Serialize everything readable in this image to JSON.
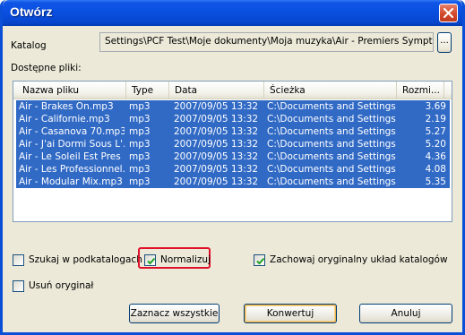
{
  "window": {
    "title": "Otwórz"
  },
  "catalog": {
    "label": "Katalog",
    "path": "Settings\\PCF Test\\Moje dokumenty\\Moja muzyka\\Air - Premiers Symptomes",
    "browse_label": "..."
  },
  "files": {
    "label": "Dostępne pliki:",
    "columns": [
      "Nazwa pliku",
      "Type",
      "Data",
      "Ścieżka",
      "Rozmi..."
    ],
    "rows": [
      [
        "Air - Brakes On.mp3",
        "mp3",
        "2007/09/05 13:32",
        "C:\\Documents and Settings...",
        "3.69"
      ],
      [
        "Air - Californie.mp3",
        "mp3",
        "2007/09/05 13:32",
        "C:\\Documents and Settings...",
        "2.19"
      ],
      [
        "Air - Casanova 70.mp3",
        "mp3",
        "2007/09/05 13:32",
        "C:\\Documents and Settings...",
        "5.27"
      ],
      [
        "Air - J'ai Dormi Sous L'...",
        "mp3",
        "2007/09/05 13:32",
        "C:\\Documents and Settings...",
        "5.20"
      ],
      [
        "Air - Le Soleil Est Pres ...",
        "mp3",
        "2007/09/05 13:32",
        "C:\\Documents and Settings...",
        "4.36"
      ],
      [
        "Air - Les Professionnel...",
        "mp3",
        "2007/09/05 13:32",
        "C:\\Documents and Settings...",
        "4.08"
      ],
      [
        "Air - Modular Mix.mp3",
        "mp3",
        "2007/09/05 13:32",
        "C:\\Documents and Settings...",
        "5.35"
      ]
    ],
    "selection_color": "#316ac5"
  },
  "options": {
    "subfolders": {
      "label": "Szukaj w podkatalogach",
      "checked": false
    },
    "normalize": {
      "label": "Normalizuj",
      "checked": true
    },
    "keep_structure": {
      "label": "Zachowaj oryginalny układ katalogów",
      "checked": true
    },
    "delete_original": {
      "label": "Usuń oryginał",
      "checked": false
    }
  },
  "buttons": {
    "select_all": "Zaznacz wszystkie",
    "convert": "Konwertuj",
    "cancel": "Anuluj"
  },
  "colors": {
    "highlight": "#e0102a",
    "titlebar": "#0a50e0"
  }
}
